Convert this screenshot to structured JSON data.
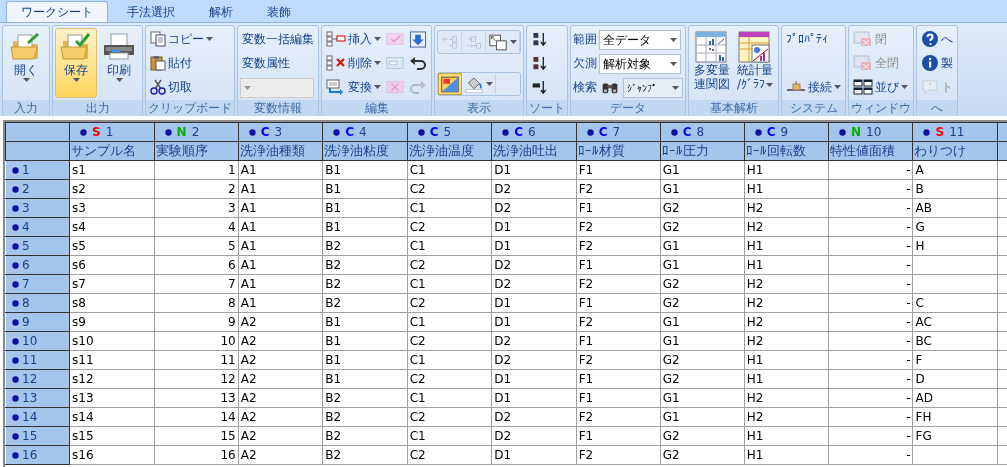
{
  "tabs": [
    {
      "label": "ワークシート",
      "selected": true
    },
    {
      "label": "手法選択",
      "selected": false
    },
    {
      "label": "解析",
      "selected": false
    },
    {
      "label": "装飾",
      "selected": false
    }
  ],
  "ribbon": {
    "groups": [
      {
        "label": "入力",
        "columns": [
          [
            {
              "kind": "large",
              "lines": [
                "開く"
              ],
              "dropdown": true,
              "highlighted": false
            }
          ]
        ]
      },
      {
        "label": "出力",
        "columns": [
          [
            {
              "kind": "large",
              "lines": [
                "保存"
              ],
              "dropdown": true,
              "highlighted": true
            }
          ],
          [
            {
              "kind": "large",
              "lines": [
                "印刷"
              ],
              "dropdown": true,
              "highlighted": false
            }
          ]
        ]
      },
      {
        "label": "クリップボード",
        "columns": [
          [
            {
              "kind": "small",
              "label": "コピー",
              "dropdown": true,
              "disabled": false
            },
            {
              "kind": "small",
              "label": "貼付",
              "dropdown": false,
              "disabled": false
            },
            {
              "kind": "small",
              "label": "切取",
              "dropdown": false,
              "disabled": false
            }
          ]
        ]
      },
      {
        "label": "変数情報",
        "columns": [
          [
            {
              "kind": "text",
              "label": "変数一括編集"
            },
            {
              "kind": "text",
              "label": "変数属性"
            },
            {
              "kind": "combo",
              "disabled": true
            }
          ]
        ]
      },
      {
        "label": "編集",
        "columns": [
          [
            {
              "kind": "small",
              "label": "挿入",
              "dropdown": true,
              "disabled": false
            },
            {
              "kind": "small",
              "label": "削除",
              "dropdown": true,
              "disabled": false
            },
            {
              "kind": "small",
              "label": "変換",
              "dropdown": true,
              "disabled": false
            }
          ],
          [
            {
              "kind": "icon",
              "disabled": true
            },
            {
              "kind": "icon",
              "disabled": true
            },
            {
              "kind": "icon",
              "disabled": true
            }
          ],
          [
            {
              "kind": "icon",
              "disabled": false
            },
            {
              "kind": "icon",
              "disabled": false
            },
            {
              "kind": "icon",
              "disabled": true
            }
          ]
        ]
      },
      {
        "label": "表示",
        "columns": [
          [
            {
              "kind": "strip",
              "buttons": [
                {
                  "disabled": true,
                  "dropdown": false,
                  "selected": false
                },
                {
                  "disabled": true,
                  "dropdown": false,
                  "selected": false
                },
                {
                  "disabled": false,
                  "dropdown": true,
                  "selected": false
                }
              ]
            },
            {
              "kind": "strip",
              "buttons": [
                {
                  "disabled": false,
                  "dropdown": false,
                  "selected": true
                },
                {
                  "disabled": false,
                  "dropdown": true,
                  "selected": false
                }
              ]
            }
          ]
        ]
      },
      {
        "label": "ソート",
        "columns": [
          [
            {
              "kind": "icon",
              "disabled": false
            },
            {
              "kind": "icon",
              "disabled": false
            },
            {
              "kind": "icon",
              "disabled": false
            }
          ]
        ]
      },
      {
        "label": "データ",
        "columns": [
          [
            {
              "kind": "field",
              "label": "範囲",
              "value": "全データ"
            },
            {
              "kind": "field",
              "label": "欠測",
              "value": "解析対象"
            },
            {
              "kind": "search",
              "label": "検索",
              "value": "ｼﾞｬﾝﾌﾟ"
            }
          ]
        ]
      },
      {
        "label": "基本解析",
        "columns": [
          [
            {
              "kind": "large",
              "lines": [
                "多変量",
                "連関図"
              ],
              "dropdown": false,
              "highlighted": false
            }
          ],
          [
            {
              "kind": "large",
              "lines": [
                "統計量",
                "/ｸﾞﾗﾌ"
              ],
              "dropdown": true,
              "highlighted": false
            }
          ]
        ]
      },
      {
        "label": "システム",
        "columns": [
          [
            {
              "kind": "text",
              "label": "ﾌﾟﾛﾊﾟﾃｨ"
            },
            {
              "kind": "small",
              "label": "接続",
              "dropdown": true,
              "disabled": false
            }
          ]
        ]
      },
      {
        "label": "ウィンドウ",
        "columns": [
          [
            {
              "kind": "small",
              "label": "閉",
              "dropdown": false,
              "disabled": true
            },
            {
              "kind": "small",
              "label": "全閉",
              "dropdown": false,
              "disabled": true
            },
            {
              "kind": "small",
              "label": "並び",
              "dropdown": true,
              "disabled": false
            }
          ]
        ]
      },
      {
        "label": "へ",
        "columns": [
          [
            {
              "kind": "small",
              "label": "へ",
              "dropdown": false,
              "disabled": false
            },
            {
              "kind": "small",
              "label": "製",
              "dropdown": false,
              "disabled": false
            },
            {
              "kind": "small",
              "label": "ト",
              "dropdown": false,
              "disabled": true
            }
          ]
        ]
      }
    ]
  },
  "grid": {
    "columns": [
      {
        "type": "S",
        "color": "#ff0000",
        "number": "1",
        "name": "サンプル名"
      },
      {
        "type": "N",
        "color": "#00b000",
        "number": "2",
        "name": "実験順序"
      },
      {
        "type": "C",
        "color": "#0000ff",
        "number": "3",
        "name": "洗浄油種類"
      },
      {
        "type": "C",
        "color": "#0000ff",
        "number": "4",
        "name": "洗浄油粘度"
      },
      {
        "type": "C",
        "color": "#0000ff",
        "number": "5",
        "name": "洗浄油温度"
      },
      {
        "type": "C",
        "color": "#0000ff",
        "number": "6",
        "name": "洗浄油吐出"
      },
      {
        "type": "C",
        "color": "#0000ff",
        "number": "7",
        "name": "ﾛｰﾙ材質"
      },
      {
        "type": "C",
        "color": "#0000ff",
        "number": "8",
        "name": "ﾛｰﾙ圧力"
      },
      {
        "type": "C",
        "color": "#0000ff",
        "number": "9",
        "name": "ﾛｰﾙ回転数"
      },
      {
        "type": "N",
        "color": "#00b000",
        "number": "10",
        "name": "特性値面積"
      },
      {
        "type": "S",
        "color": "#ff0000",
        "number": "11",
        "name": "わりつけ"
      }
    ],
    "rows": [
      {
        "number": "1",
        "cells": [
          "s1",
          "1",
          "A1",
          "B1",
          "C1",
          "D1",
          "F1",
          "G1",
          "H1",
          "-",
          "A"
        ]
      },
      {
        "number": "2",
        "cells": [
          "s2",
          "2",
          "A1",
          "B1",
          "C2",
          "D2",
          "F2",
          "G1",
          "H1",
          "-",
          "B"
        ]
      },
      {
        "number": "3",
        "cells": [
          "s3",
          "3",
          "A1",
          "B1",
          "C1",
          "D2",
          "F1",
          "G2",
          "H2",
          "-",
          "AB"
        ]
      },
      {
        "number": "4",
        "cells": [
          "s4",
          "4",
          "A1",
          "B1",
          "C2",
          "D1",
          "F2",
          "G2",
          "H2",
          "-",
          "G"
        ]
      },
      {
        "number": "5",
        "cells": [
          "s5",
          "5",
          "A1",
          "B2",
          "C1",
          "D1",
          "F2",
          "G1",
          "H1",
          "-",
          "H"
        ]
      },
      {
        "number": "6",
        "cells": [
          "s6",
          "6",
          "A1",
          "B2",
          "C2",
          "D2",
          "F1",
          "G1",
          "H1",
          "-",
          ""
        ]
      },
      {
        "number": "7",
        "cells": [
          "s7",
          "7",
          "A1",
          "B2",
          "C1",
          "D2",
          "F2",
          "G2",
          "H2",
          "-",
          ""
        ]
      },
      {
        "number": "8",
        "cells": [
          "s8",
          "8",
          "A1",
          "B2",
          "C2",
          "D1",
          "F1",
          "G2",
          "H2",
          "-",
          "C"
        ]
      },
      {
        "number": "9",
        "cells": [
          "s9",
          "9",
          "A2",
          "B1",
          "C1",
          "D1",
          "F2",
          "G1",
          "H2",
          "-",
          "AC"
        ]
      },
      {
        "number": "10",
        "cells": [
          "s10",
          "10",
          "A2",
          "B1",
          "C2",
          "D2",
          "F1",
          "G1",
          "H2",
          "-",
          "BC"
        ]
      },
      {
        "number": "11",
        "cells": [
          "s11",
          "11",
          "A2",
          "B1",
          "C1",
          "D2",
          "F2",
          "G2",
          "H1",
          "-",
          "F"
        ]
      },
      {
        "number": "12",
        "cells": [
          "s12",
          "12",
          "A2",
          "B1",
          "C2",
          "D1",
          "F1",
          "G2",
          "H1",
          "-",
          "D"
        ]
      },
      {
        "number": "13",
        "cells": [
          "s13",
          "13",
          "A2",
          "B2",
          "C1",
          "D1",
          "F1",
          "G1",
          "H2",
          "-",
          "AD"
        ]
      },
      {
        "number": "14",
        "cells": [
          "s14",
          "14",
          "A2",
          "B2",
          "C2",
          "D2",
          "F2",
          "G1",
          "H2",
          "-",
          "FH"
        ]
      },
      {
        "number": "15",
        "cells": [
          "s15",
          "15",
          "A2",
          "B2",
          "C1",
          "D2",
          "F1",
          "G2",
          "H1",
          "-",
          "FG"
        ]
      },
      {
        "number": "16",
        "cells": [
          "s16",
          "16",
          "A2",
          "B2",
          "C2",
          "D1",
          "F2",
          "G2",
          "H1",
          "-",
          ""
        ]
      }
    ]
  }
}
